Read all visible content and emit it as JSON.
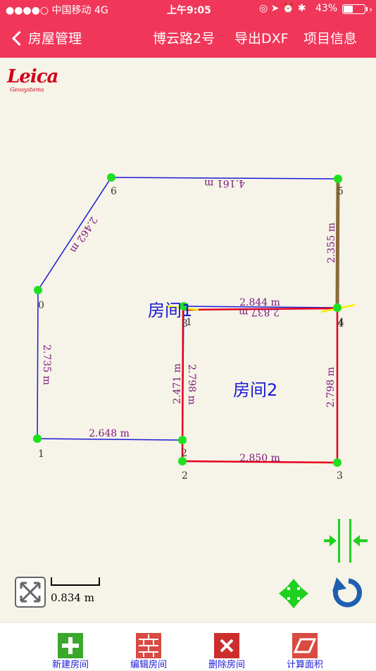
{
  "status_bar": {
    "carrier": "●●●●○ 中国移动  4G",
    "time": "上午9:05",
    "battery": "43%"
  },
  "nav": {
    "back_label": "房屋管理",
    "title": "博云路2号",
    "export_label": "导出DXF",
    "info_label": "项目信息"
  },
  "logo": {
    "brand": "Leica",
    "sub": "Geosystems"
  },
  "drawing": {
    "room1_label": "房间1",
    "room2_label": "房间2",
    "room1_points": [
      "0",
      "1",
      "2",
      "3",
      "4",
      "5",
      "6"
    ],
    "room2_points": [
      "1",
      "2",
      "3",
      "4"
    ],
    "room1_edges": [
      "2.735 m",
      "2.648 m",
      "2.471 m",
      "2.837 m",
      "2.355 m",
      "4.161 m",
      "2.462 m"
    ],
    "room2_edges": [
      "2.798 m",
      "2.850 m",
      "2.798 m",
      "2.844 m"
    ]
  },
  "scale": {
    "label": "0.834 m"
  },
  "toolbar": {
    "new_room": "新建房间",
    "edit_room": "编辑房间",
    "delete_room": "删除房间",
    "calc_area": "计算面积"
  },
  "colors": {
    "header": "#f0375a",
    "room1_line": "#1a1ad6",
    "room2_line": "#e8001c",
    "point": "#1fe01f",
    "dim_text": "#7a1a7a",
    "active_edge": "#8a6a3a",
    "selection": "#f5f000"
  }
}
